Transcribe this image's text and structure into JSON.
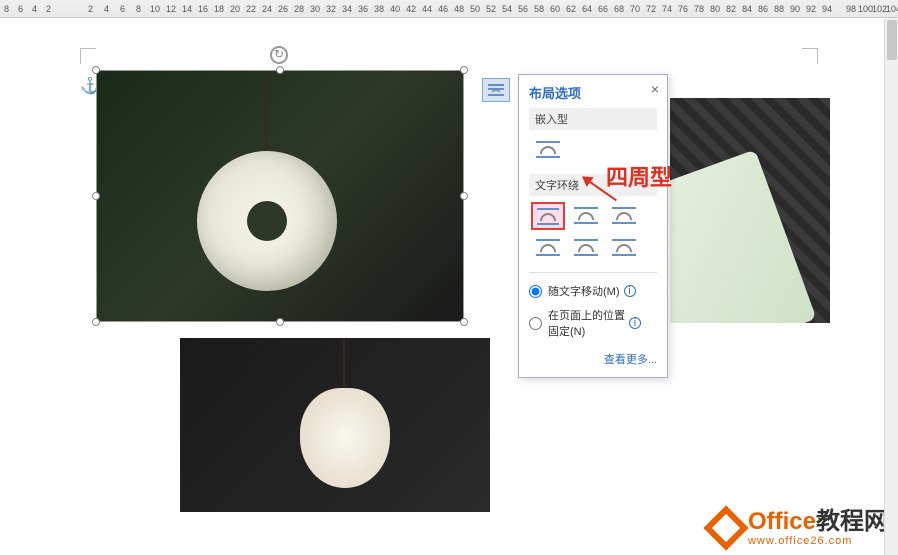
{
  "ruler": {
    "marks": [
      "8",
      "6",
      "4",
      "2",
      "",
      "2",
      "4",
      "6",
      "8",
      "10",
      "12",
      "14",
      "16",
      "18",
      "20",
      "22",
      "24",
      "26",
      "28",
      "30",
      "32",
      "34",
      "36",
      "38",
      "40",
      "42",
      "44",
      "46",
      "48",
      "50",
      "52",
      "54",
      "56",
      "58",
      "60",
      "62",
      "64",
      "66",
      "68",
      "70",
      "72",
      "74",
      "76",
      "78",
      "80",
      "82",
      "84",
      "86",
      "88",
      "90",
      "92",
      "94",
      "",
      "98",
      "100",
      "102",
      "104"
    ]
  },
  "layout_popup": {
    "title": "布局选项",
    "section_inline": "嵌入型",
    "section_wrap": "文字环绕",
    "radio_move": "随文字移动(M)",
    "radio_fixed_line1": "在页面上的位置",
    "radio_fixed_line2": "固定(N)",
    "see_more": "查看更多...",
    "close": "×"
  },
  "annotation": {
    "label": "四周型"
  },
  "watermark": {
    "brand_en": "Office",
    "brand_cn": "教程网",
    "url": "www.office26.com"
  }
}
